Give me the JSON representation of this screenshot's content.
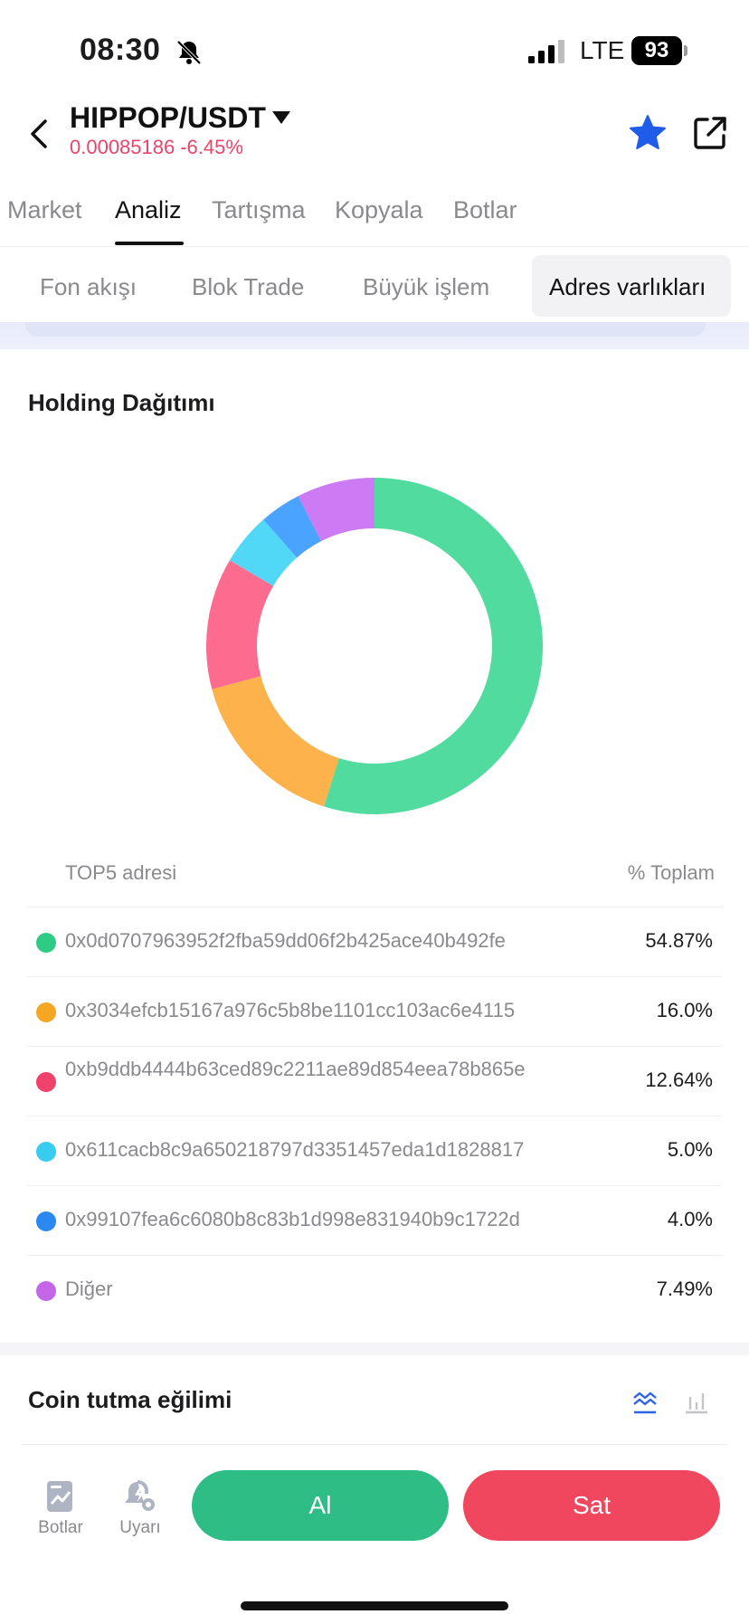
{
  "status_bar": {
    "time": "08:30",
    "network": "LTE",
    "battery": "93"
  },
  "header": {
    "pair": "HIPPOP/USDT",
    "price": "0.00085186",
    "change": "-6.45%"
  },
  "main_tabs": [
    "Market",
    "Analiz",
    "Tartışma",
    "Kopyala",
    "Botlar"
  ],
  "sub_tabs": [
    "Fon akışı",
    "Blok Trade",
    "Büyük işlem",
    "Adres varlıkları"
  ],
  "holding": {
    "title": "Holding Dağıtımı",
    "col_address": "TOP5 adresi",
    "col_percent": "% Toplam",
    "rows": [
      {
        "address": "0x0d0707963952f2fba59dd06f2b425ace40b492fe",
        "percent": "54.87%",
        "color": "#2ecb84"
      },
      {
        "address": "0x3034efcb15167a976c5b8be1101cc103ac6e4115",
        "percent": "16.0%",
        "color": "#f5a623"
      },
      {
        "address": "0xb9ddb4444b63ced89c2211ae89d854eea78b865e",
        "percent": "12.64%",
        "color": "#f0426a"
      },
      {
        "address": "0x611cacb8c9a650218797d3351457eda1d1828817",
        "percent": "5.0%",
        "color": "#38ccf0"
      },
      {
        "address": "0x99107fea6c6080b8c83b1d998e831940b9c1722d",
        "percent": "4.0%",
        "color": "#2a88f0"
      },
      {
        "address": "Diğer",
        "percent": "7.49%",
        "color": "#c466e8"
      }
    ]
  },
  "chart_data": {
    "type": "pie",
    "categories": [
      "0x0d0707963952f2fba59dd06f2b425ace40b492fe",
      "0x3034efcb15167a976c5b8be1101cc103ac6e4115",
      "0xb9ddb4444b63ced89c2211ae89d854eea78b865e",
      "0x611cacb8c9a650218797d3351457eda1d1828817",
      "0x99107fea6c6080b8c83b1d998e831940b9c1722d",
      "Diğer"
    ],
    "values": [
      54.87,
      16.0,
      12.64,
      5.0,
      4.0,
      7.49
    ],
    "colors": [
      "#52db9f",
      "#fdb24b",
      "#fd6b8e",
      "#52d8f7",
      "#4aa3ff",
      "#cc7bf4"
    ]
  },
  "trend": {
    "title": "Coin tutma eğilimi"
  },
  "bottom": {
    "bots_label": "Botlar",
    "alerts_label": "Uyarı",
    "buy_label": "Al",
    "sell_label": "Sat"
  }
}
